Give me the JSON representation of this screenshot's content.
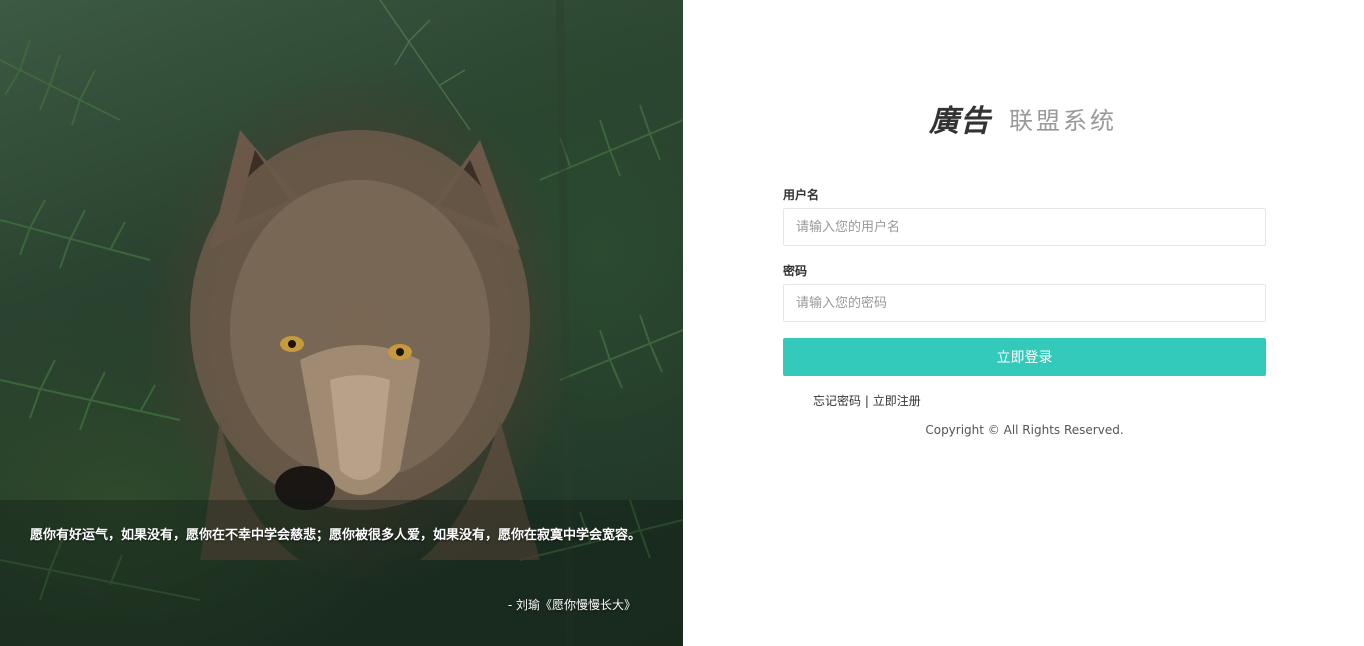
{
  "hero": {
    "image_subject": "wolf in pine forest",
    "quote": "愿你有好运气，如果没有，愿你在不幸中学会慈悲；愿你被很多人爱，如果没有，愿你在寂寞中学会宽容。",
    "author": "- 刘瑜《愿你慢慢长大》"
  },
  "brand": {
    "logo_mark": "廣告",
    "title": "联盟系统"
  },
  "form": {
    "username_label": "用户名",
    "username_placeholder": "请输入您的用户名",
    "username_value": "",
    "password_label": "密码",
    "password_placeholder": "请输入您的密码",
    "password_value": "",
    "submit_label": "立即登录",
    "forgot_label": "忘记密码",
    "separator": " | ",
    "register_label": "立即注册"
  },
  "footer": {
    "copyright": "Copyright © All Rights Reserved."
  },
  "colors": {
    "accent": "#33cabb",
    "logo_text": "#9a9a9a"
  }
}
